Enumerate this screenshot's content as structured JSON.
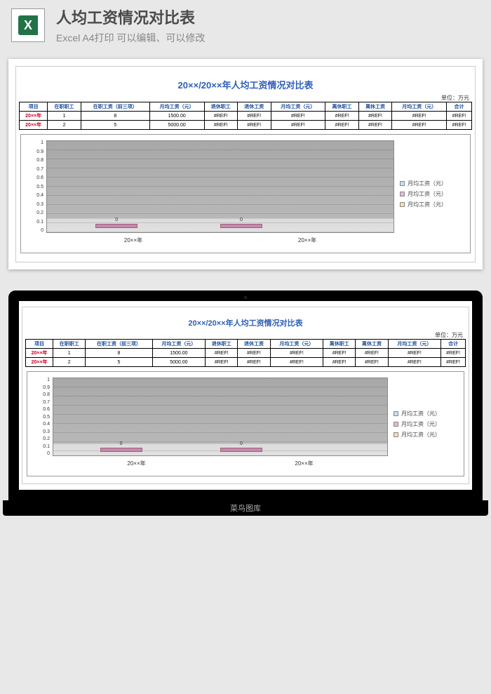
{
  "header": {
    "title": "人均工资情况对比表",
    "subtitle": "Excel A4打印 可以编辑、可以修改"
  },
  "sheet": {
    "title": "20××/20××年人均工资情况对比表",
    "unit": "单位：万元",
    "columns": [
      "项目",
      "在职职工",
      "在职工资（前三项）",
      "月均工资（元）",
      "退休职工",
      "退休工资",
      "月均工资（元）",
      "离休职工",
      "离休工资",
      "月均工资（元）",
      "合计"
    ],
    "rows": [
      {
        "head": "20××年",
        "cells": [
          "1",
          "8",
          "1500.00",
          "#REF!",
          "#REF!",
          "#REF!",
          "#REF!",
          "#REF!",
          "#REF!",
          "#REF!"
        ]
      },
      {
        "head": "20××年",
        "cells": [
          "2",
          "5",
          "5000.00",
          "#REF!",
          "#REF!",
          "#REF!",
          "#REF!",
          "#REF!",
          "#REF!",
          "#REF!"
        ]
      }
    ]
  },
  "chart_data": {
    "type": "bar",
    "categories": [
      "20××年",
      "20××年"
    ],
    "series": [
      {
        "name": "月均工资（元）",
        "values": [
          0,
          0
        ]
      },
      {
        "name": "月均工资（元）",
        "values": [
          0,
          0
        ]
      },
      {
        "name": "月均工资（元）",
        "values": [
          0,
          0
        ]
      }
    ],
    "ylim": [
      0,
      1
    ],
    "yticks": [
      "0",
      "0.1",
      "0.2",
      "0.3",
      "0.4",
      "0.5",
      "0.6",
      "0.7",
      "0.8",
      "0.9",
      "1"
    ]
  },
  "footer": {
    "watermark": "菜鸟图库"
  }
}
